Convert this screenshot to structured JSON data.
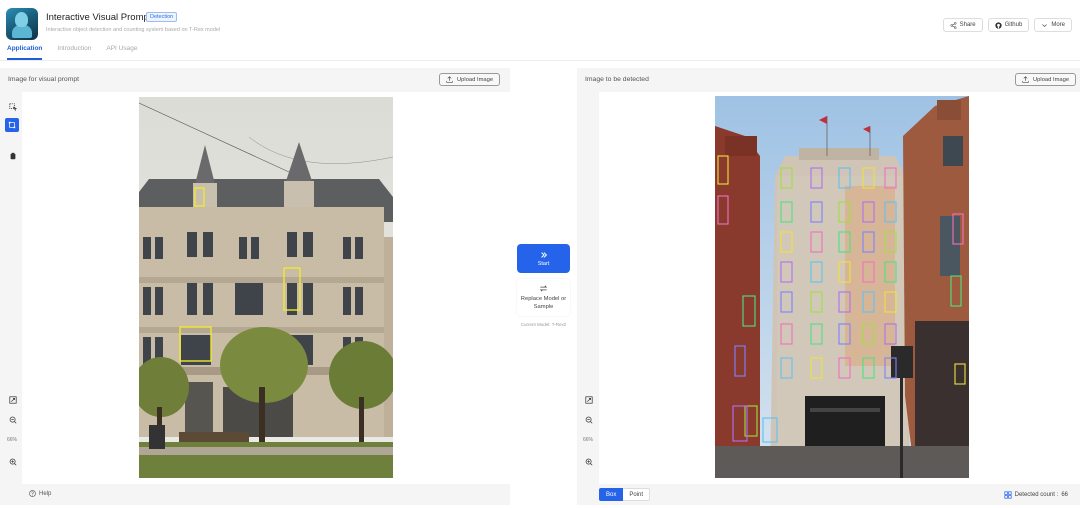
{
  "header": {
    "title": "Interactive Visual Prompt",
    "badge": "Detection",
    "subtitle": "Interactive object detection and counting system based on T-Rex model",
    "buttons": [
      {
        "label": "Share",
        "icon": "share-icon"
      },
      {
        "label": "Github",
        "icon": "github-icon"
      },
      {
        "label": "More",
        "icon": "chevron-down-icon"
      }
    ]
  },
  "tabs": [
    {
      "label": "Application",
      "active": true
    },
    {
      "label": "Introduction",
      "active": false
    },
    {
      "label": "API Usage",
      "active": false
    }
  ],
  "left_panel": {
    "title": "Image for visual prompt",
    "upload_label": "Upload Image",
    "zoom": "66%",
    "help_label": "Help",
    "tools": [
      "select-tool-icon",
      "box-tool-icon",
      "clear-tool-icon"
    ]
  },
  "middle": {
    "start_label": "Start",
    "replace_label": "Replace Model or Sample",
    "current_model": "Current Model: T-Rex2"
  },
  "right_panel": {
    "title": "Image to be detected",
    "upload_label": "Upload Image",
    "zoom": "66%",
    "modes": [
      {
        "label": "Box",
        "active": true
      },
      {
        "label": "Point",
        "active": false
      }
    ],
    "detected_label": "Detected count :",
    "detected_count": "66"
  },
  "colors": {
    "accent": "#2563eb",
    "prompt_box": "#f0e830",
    "panel_bg": "#f5f5f5"
  }
}
